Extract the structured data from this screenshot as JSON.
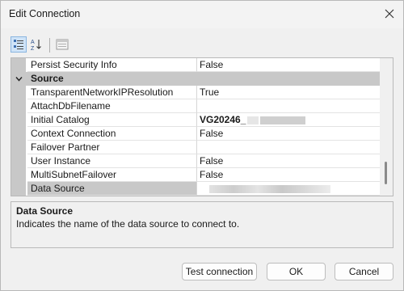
{
  "window": {
    "title": "Edit Connection"
  },
  "toolbar": {
    "categorized_icon": "categorized-view-icon",
    "alphabetical_icon": "alphabetical-sort-icon",
    "property_pages_icon": "property-pages-icon"
  },
  "grid": {
    "rows": [
      {
        "kind": "property",
        "name": "Persist Security Info",
        "value": "False"
      },
      {
        "kind": "category",
        "name": "Source"
      },
      {
        "kind": "property",
        "name": "TransparentNetworkIPResolution",
        "value": "True"
      },
      {
        "kind": "property",
        "name": "AttachDbFilename",
        "value": ""
      },
      {
        "kind": "property",
        "name": "Initial Catalog",
        "value": "VG20246_"
      },
      {
        "kind": "property",
        "name": "Context Connection",
        "value": "False"
      },
      {
        "kind": "property",
        "name": "Failover Partner",
        "value": ""
      },
      {
        "kind": "property",
        "name": "User Instance",
        "value": "False"
      },
      {
        "kind": "property",
        "name": "MultiSubnetFailover",
        "value": "False"
      },
      {
        "kind": "property",
        "name": "Data Source",
        "value": ""
      }
    ]
  },
  "description": {
    "title": "Data Source",
    "text": "Indicates the name of the data source to connect to."
  },
  "buttons": {
    "test": "Test connection",
    "ok": "OK",
    "cancel": "Cancel"
  }
}
